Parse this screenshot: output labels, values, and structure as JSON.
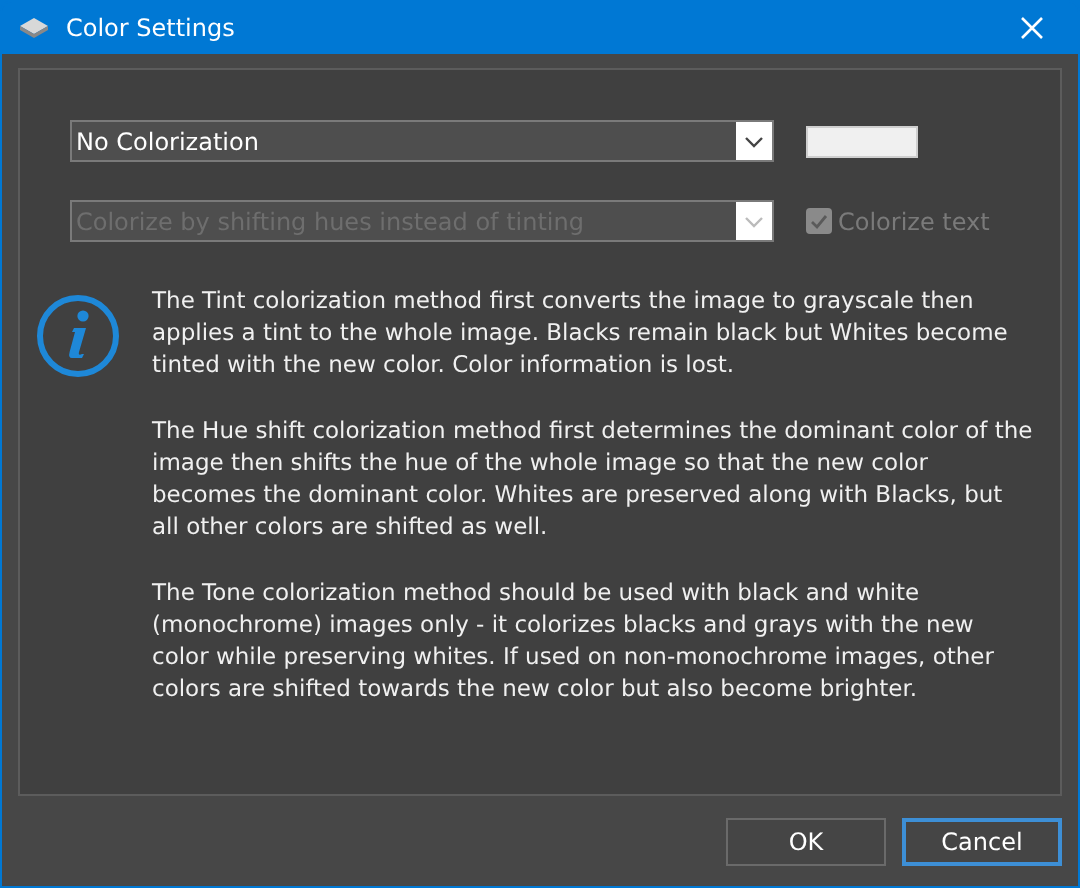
{
  "window": {
    "title": "Color Settings"
  },
  "colorization": {
    "value": "No Colorization",
    "disabled": false
  },
  "method": {
    "value": "Colorize by shifting hues instead of tinting",
    "disabled": true
  },
  "colorize_text": {
    "label": "Colorize text",
    "checked": true,
    "disabled": true
  },
  "info_paragraphs": [
    "The Tint colorization method first converts the image to grayscale then applies a tint to the whole image. Blacks remain black but Whites become tinted with the new color. Color information is lost.",
    "The Hue shift colorization method first determines the dominant color of the image then shifts the hue of the whole image so that the new color becomes the dominant color. Whites are preserved along with Blacks, but all other colors are shifted as well.",
    "The Tone colorization method should be used with black and white (monochrome) images only - it colorizes blacks and grays with the new color while preserving whites. If used on non-monochrome images, other colors are shifted towards the new color but also become brighter."
  ],
  "buttons": [
    {
      "label": "OK",
      "focused": false
    },
    {
      "label": "Cancel",
      "focused": true
    }
  ]
}
